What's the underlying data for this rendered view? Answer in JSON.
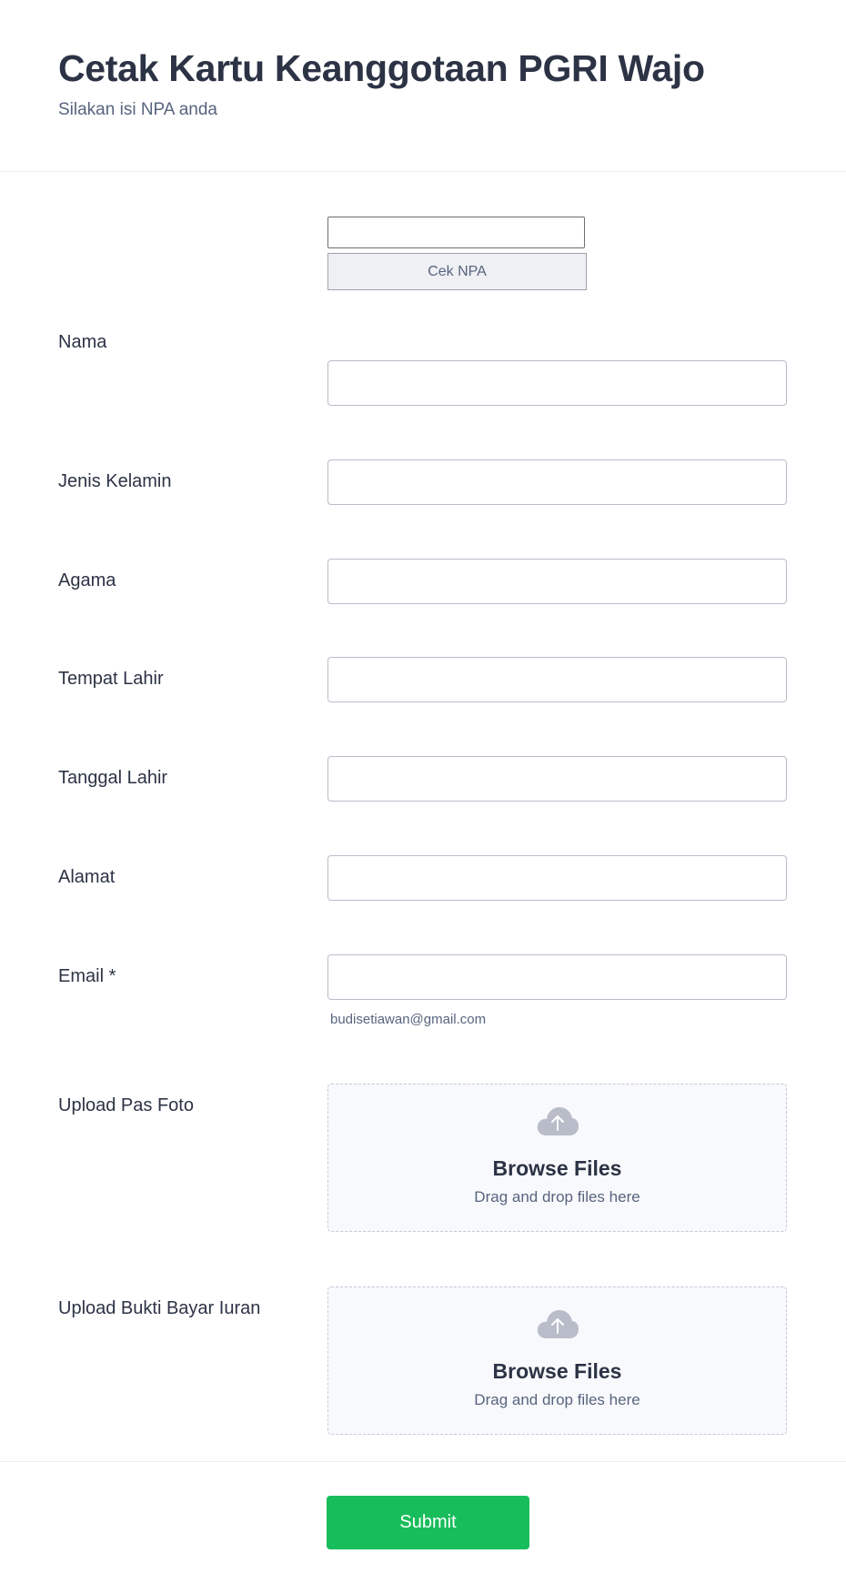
{
  "header": {
    "title": "Cetak Kartu Keanggotaan PGRI Wajo",
    "subtitle": "Silakan isi NPA anda"
  },
  "npa": {
    "input_value": "",
    "button_label": "Cek NPA"
  },
  "fields": [
    {
      "label": "Nama",
      "value": ""
    },
    {
      "label": "Jenis Kelamin",
      "value": ""
    },
    {
      "label": "Agama",
      "value": ""
    },
    {
      "label": "Tempat Lahir",
      "value": ""
    },
    {
      "label": "Tanggal Lahir",
      "value": ""
    },
    {
      "label": "Alamat",
      "value": ""
    },
    {
      "label": "Email *",
      "value": "",
      "hint": "budisetiawan@gmail.com"
    }
  ],
  "uploads": [
    {
      "label": "Upload Pas Foto",
      "button": "Browse Files",
      "hint": "Drag and drop files here",
      "icon": "cloud-upload-icon"
    },
    {
      "label": "Upload Bukti Bayar Iuran",
      "button": "Browse Files",
      "hint": "Drag and drop files here",
      "icon": "cloud-upload-icon"
    }
  ],
  "submit_label": "Submit",
  "colors": {
    "accent": "#18bd5b",
    "text": "#2c3345",
    "muted": "#57647e"
  }
}
